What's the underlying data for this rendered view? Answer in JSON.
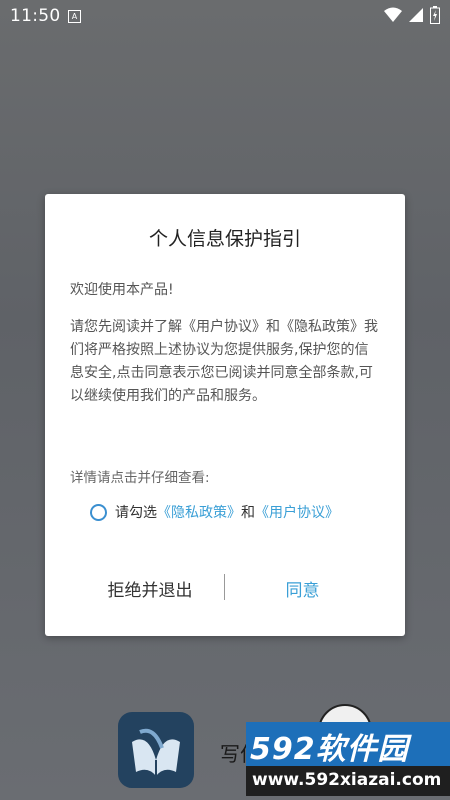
{
  "status_bar": {
    "time": "11:50",
    "notification_letter": "A",
    "icons": [
      "wifi-icon",
      "signal-icon",
      "battery-icon"
    ]
  },
  "background_app": {
    "name": "写作",
    "logo_icon": "book-logo-icon"
  },
  "watermark": {
    "title": "592软件园",
    "url": "www.592xiazai.com"
  },
  "dialog": {
    "title": "个人信息保护指引",
    "welcome": "欢迎使用本产品!",
    "body": "请您先阅读并了解《用户协议》和《隐私政策》我们将严格按照上述协议为您提供服务,保护您的信息安全,点击同意表示您已阅读并同意全部条款,可以继续使用我们的产品和服务。",
    "details_prompt": "详情请点击并仔细查看:",
    "consent_prefix": "请勾选",
    "privacy_link": "《隐私政策》",
    "and_text": "和",
    "user_agreement_link": "《用户协议》",
    "decline_label": "拒绝并退出",
    "agree_label": "同意"
  },
  "colors": {
    "accent": "#3a9fd6",
    "dim_background": "#62656a"
  }
}
